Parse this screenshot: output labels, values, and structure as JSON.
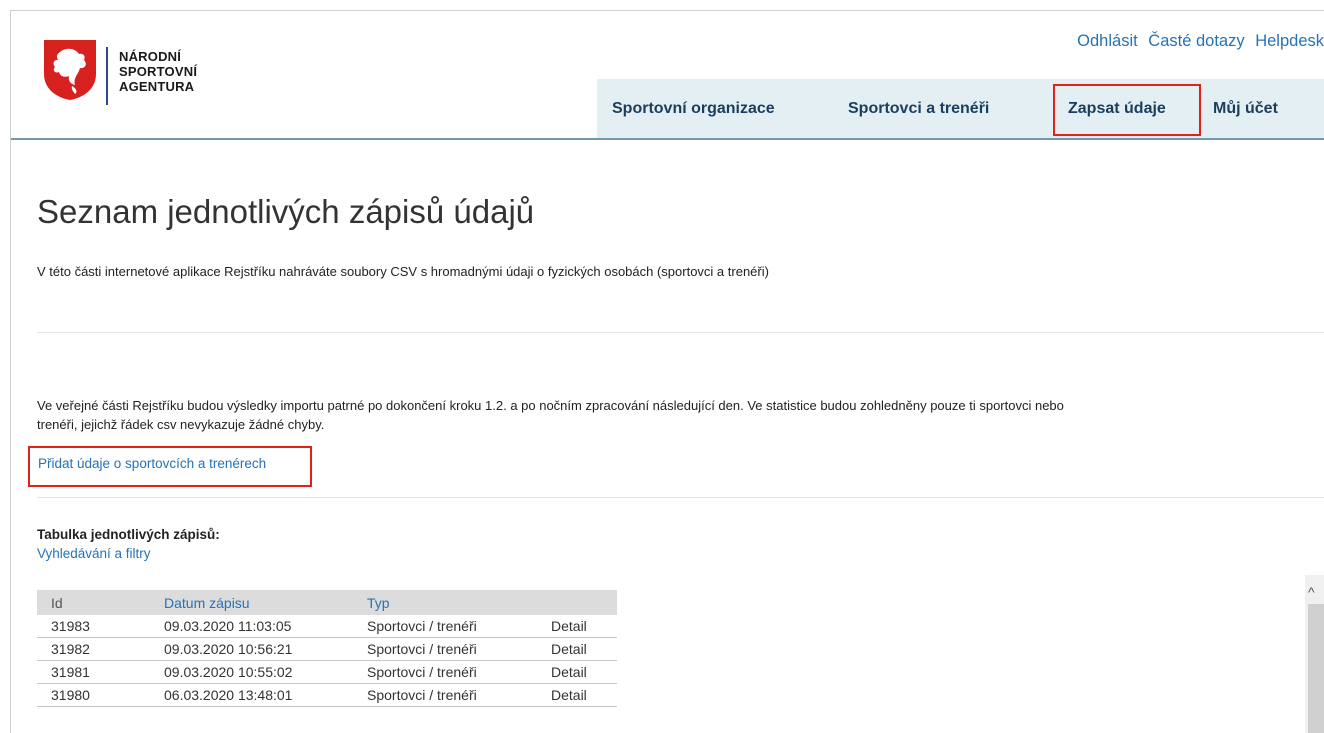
{
  "logo": {
    "line1": "NÁRODNÍ",
    "line2": "SPORTOVNÍ",
    "line3": "AGENTURA",
    "shield_color": "#d7211f"
  },
  "toplinks": {
    "logout": "Odhlásit",
    "faq": "Časté dotazy",
    "helpdesk": "Helpdesk"
  },
  "nav": {
    "organizations": "Sportovní organizace",
    "athletes": "Sportovci a trenéři",
    "enter_data": "Zapsat údaje",
    "account": "Můj účet"
  },
  "page": {
    "title": "Seznam jednotlivých zápisů údajů",
    "intro": "V této části internetové aplikace Rejstříku nahráváte soubory CSV s hromadnými údaji o fyzických osobách (sportovci a trenéři)",
    "notice_line1": "Ve veřejné části Rejstříku budou výsledky importu patrné po dokončení kroku 1.2. a po nočním zpracování následující den. Ve statistice budou zohledněny pouze ti sportovci nebo",
    "notice_line2": "trenéři, jejichž řádek csv nevykazuje žádné chyby.",
    "add_link": "Přidat údaje o sportovcích a trenérech",
    "table_caption": "Tabulka jednotlivých zápisů:",
    "filter_link": "Vyhledávání a filtry"
  },
  "table": {
    "headers": [
      "Id",
      "Datum zápisu",
      "Typ",
      ""
    ],
    "rows": [
      {
        "id": "31983",
        "date": "09.03.2020 11:03:05",
        "type": "Sportovci / trenéři",
        "action": "Detail"
      },
      {
        "id": "31982",
        "date": "09.03.2020 10:56:21",
        "type": "Sportovci / trenéři",
        "action": "Detail"
      },
      {
        "id": "31981",
        "date": "09.03.2020 10:55:02",
        "type": "Sportovci / trenéři",
        "action": "Detail"
      },
      {
        "id": "31980",
        "date": "06.03.2020 13:48:01",
        "type": "Sportovci / trenéři",
        "action": "Detail"
      }
    ]
  },
  "colors": {
    "link": "#2672b6",
    "nav_bg": "#e4eff3",
    "nav_text": "#1a3f5e",
    "highlight": "#e0211c",
    "header_rule": "#6f9aa9"
  },
  "icons": {
    "scroll_up": "chevron-up-icon",
    "logo_shield": "czech-lion-shield-icon"
  }
}
